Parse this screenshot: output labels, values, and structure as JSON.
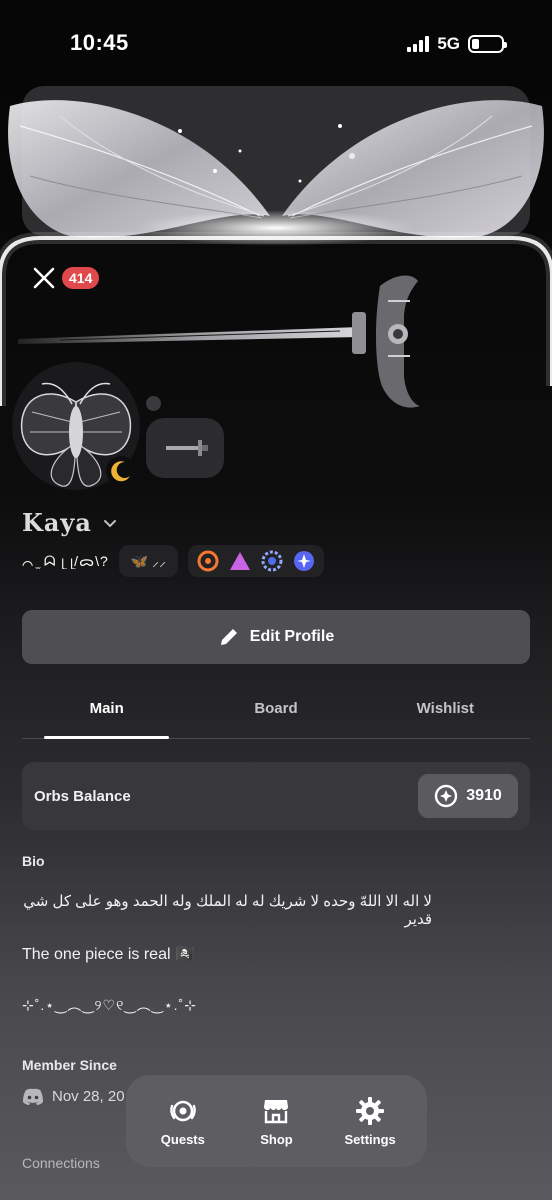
{
  "status_bar": {
    "time": "10:45",
    "network": "5G",
    "battery_level": 0.25
  },
  "header": {
    "notification_count": "414"
  },
  "profile": {
    "display_name": "Kaya",
    "pronouns": "⌒ ̫ ᗣ ᥨ ᥨ/ᯅ\\?",
    "tag": "🦋 ⸝⸝",
    "badges": [
      "hypesquad-badge",
      "nitro-triangle-badge",
      "quest-badge",
      "orb-badge"
    ]
  },
  "actions": {
    "edit_profile": "Edit Profile"
  },
  "tabs": [
    {
      "label": "Main",
      "active": true
    },
    {
      "label": "Board",
      "active": false
    },
    {
      "label": "Wishlist",
      "active": false
    }
  ],
  "orbs": {
    "label": "Orbs Balance",
    "value": "3910"
  },
  "bio": {
    "title": "Bio",
    "lines": [
      "لا اله الا اللهّ وحده لا شريك له له الملك وله الحمد وهو على كل شي قدير",
      "The one piece is real 🏴‍☠️",
      "⊹˚.⋆‿︵‿୨♡୧‿︵‿⋆.˚⊹"
    ]
  },
  "member_since": {
    "title": "Member Since",
    "date": "Nov 28, 20"
  },
  "connections": {
    "title": "Connections"
  },
  "dock": {
    "quests": "Quests",
    "shop": "Shop",
    "settings": "Settings"
  }
}
